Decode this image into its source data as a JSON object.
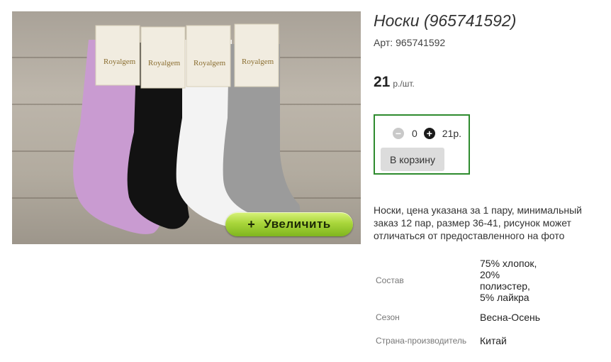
{
  "product": {
    "title": "Носки (965741592)",
    "sku_label": "Арт:",
    "sku_value": "965741592",
    "price_value": "21",
    "price_unit": "р./шт."
  },
  "image": {
    "zoom_button_label": "Увеличить",
    "zoom_button_icon": "+",
    "brand_logo_text": "Royalgem",
    "sock_colors": [
      "#c99bd1",
      "#111111",
      "#f4f4f4",
      "#9a9a9a"
    ]
  },
  "cart": {
    "minus_icon": "−",
    "plus_icon": "+",
    "quantity": "0",
    "sum": "21р.",
    "add_button_label": "В корзину",
    "accent_color": "#2e8b2e"
  },
  "description": "Носки, цена указана за 1 пару, минимальный заказ 12 пар, размер 36-41, рисунок может отличаться от предоставленного на фото",
  "properties": [
    {
      "label": "Состав",
      "value": "75% хлопок, 20% полиэстер, 5% лайкра"
    },
    {
      "label": "Сезон",
      "value": "Весна-Осень"
    },
    {
      "label": "Страна-производитель",
      "value": "Китай"
    }
  ]
}
